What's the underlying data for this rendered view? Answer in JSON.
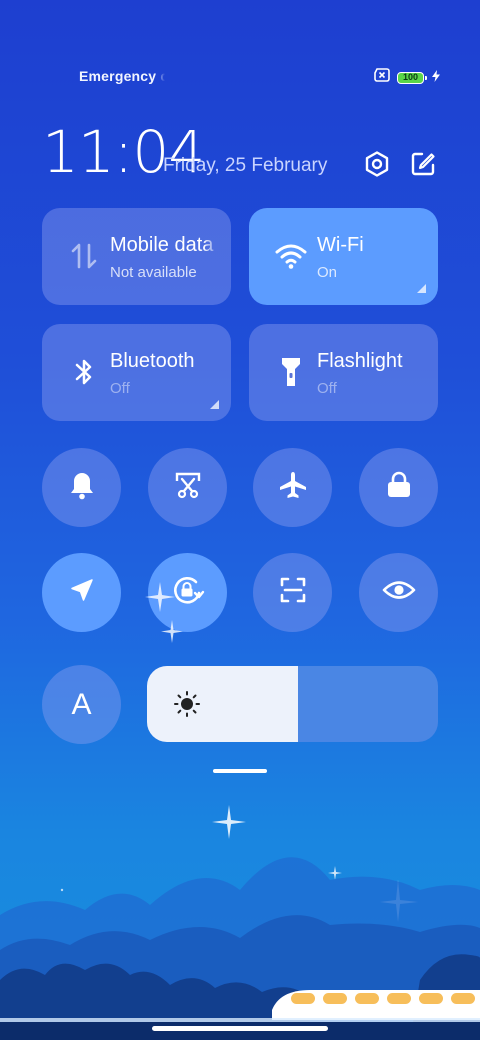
{
  "status_bar": {
    "carrier_text": "Emergency c",
    "battery_level": "100",
    "icons": [
      "sim-off-icon",
      "battery-icon",
      "charging-bolt-icon"
    ]
  },
  "header": {
    "time": "11:04",
    "date": "Friday, 25 February",
    "icons": [
      "settings-icon",
      "edit-icon"
    ]
  },
  "tiles": [
    {
      "title": "Mobile data",
      "subtitle": "Not available",
      "icon": "mobile-data-icon",
      "active": false
    },
    {
      "title": "Wi-Fi",
      "subtitle": "On",
      "icon": "wifi-icon",
      "active": true
    },
    {
      "title": "Bluetooth",
      "subtitle": "Off",
      "icon": "bluetooth-icon",
      "active": false
    },
    {
      "title": "Flashlight",
      "subtitle": "Off",
      "icon": "flashlight-icon",
      "active": false
    }
  ],
  "toggles_row1": [
    {
      "icon": "bell-icon",
      "active": false
    },
    {
      "icon": "screenshot-icon",
      "active": false
    },
    {
      "icon": "airplane-icon",
      "active": false
    },
    {
      "icon": "lock-icon",
      "active": false
    }
  ],
  "toggles_row2": [
    {
      "icon": "location-icon",
      "active": true
    },
    {
      "icon": "rotation-lock-icon",
      "active": true
    },
    {
      "icon": "scanner-icon",
      "active": false
    },
    {
      "icon": "eye-icon",
      "active": false
    }
  ],
  "auto_brightness": {
    "label": "A",
    "active": false
  },
  "brightness": {
    "level": 0.52,
    "icon": "sun-icon"
  },
  "colors": {
    "active": "#5c9cff",
    "inactive_overlay": "rgba(140,160,240,0.42)",
    "background_top": "#1e3fd0",
    "battery_fill": "#5ad64a"
  }
}
